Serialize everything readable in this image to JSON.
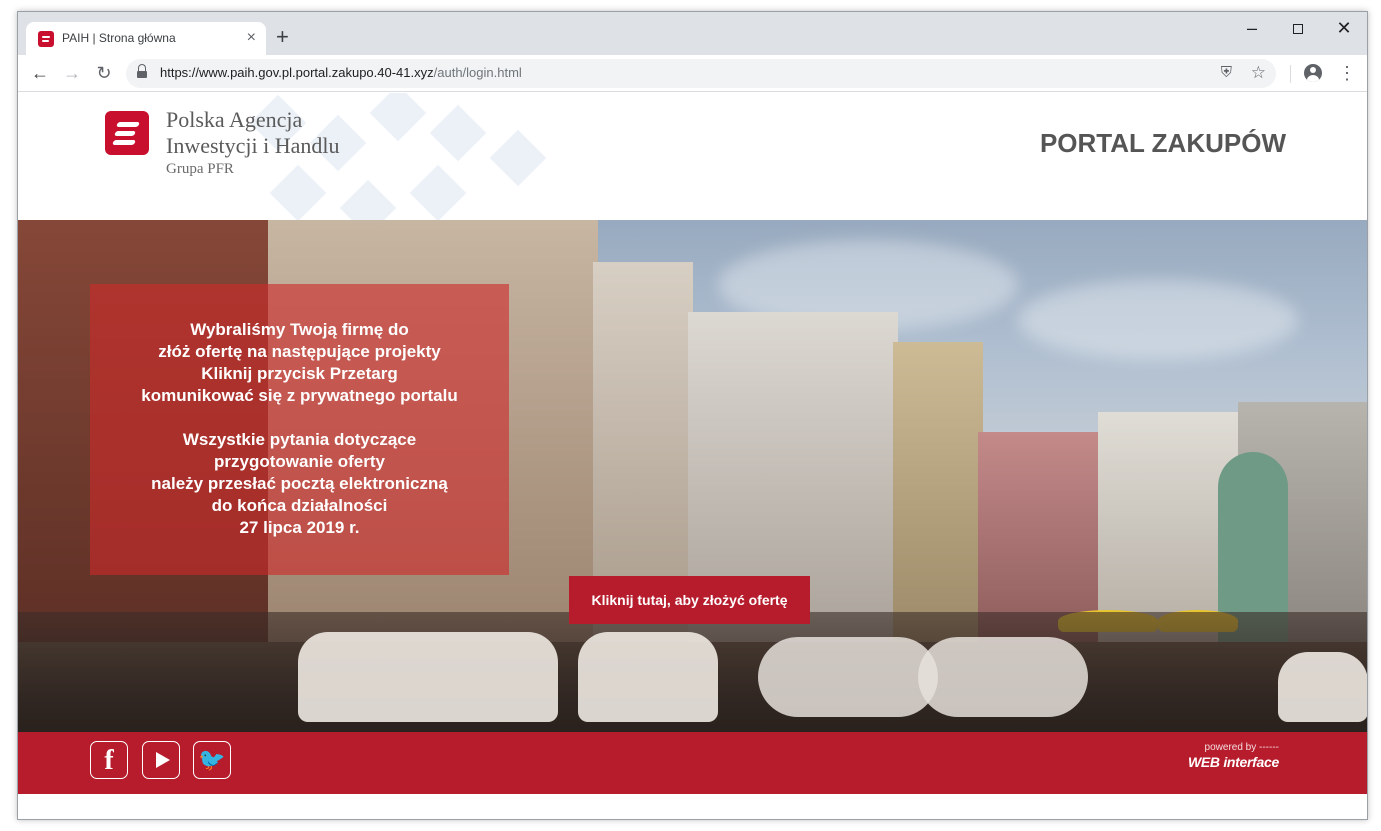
{
  "browser": {
    "tab_title": "PAIH | Strona główna",
    "tab_close": "×",
    "new_tab": "+",
    "url_host": "https://www.paih.gov.pl.portal.zakupo.40-41.xyz",
    "url_path": "/auth/login.html",
    "win_min": "–",
    "win_close": "✕",
    "back": "←",
    "forward": "→",
    "reload": "↻",
    "star": "☆",
    "menu": "⋮",
    "shield_icon": "⛨"
  },
  "header": {
    "org_name_line1": "Polska Agencja",
    "org_name_line2": "Inwestycji i Handlu",
    "org_group": "Grupa PFR",
    "portal_title": "PORTAL ZAKUPÓW"
  },
  "hero": {
    "message": "Wybraliśmy Twoją firmę do\nzłóż ofertę na następujące projekty\nKliknij przycisk Przetarg\nkomunikować się z prywatnego portalu\n\nWszystkie pytania dotyczące\nprzygotowanie oferty\nnależy przesłać pocztą elektroniczną\ndo końca działalności\n27 lipca 2019 r.",
    "cta_label": "Kliknij tutaj, aby złożyć ofertę"
  },
  "footer": {
    "facebook": "f",
    "twitter": "🐦",
    "powered_by": "powered by ------",
    "powered_brand": "WEB interface"
  },
  "colors": {
    "brand_red": "#c8102e",
    "footer_red": "#b71c2c"
  }
}
